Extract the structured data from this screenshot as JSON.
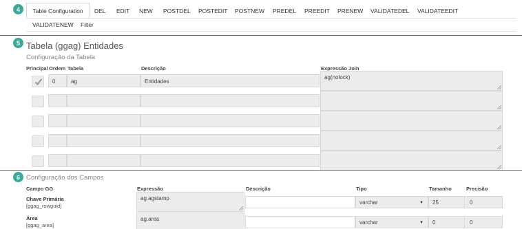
{
  "badges": {
    "tabs": "4",
    "table": "5",
    "fields": "6"
  },
  "tabs": {
    "active": "Table Configuration",
    "items": [
      "DEL",
      "EDIT",
      "NEW",
      "POSTDEL",
      "POSTEDIT",
      "POSTNEW",
      "PREDEL",
      "PREEDIT",
      "PRENEW",
      "VALIDATEDEL",
      "VALIDATEEDIT"
    ],
    "row2": [
      "VALIDATENEW",
      "Filter"
    ]
  },
  "table_section": {
    "title": "Tabela (ggag) Entidades",
    "subtitle": "Configuração da Tabela",
    "headers": {
      "principal": "Principal",
      "ordem": "Ordem",
      "tabela": "Tabela",
      "descricao": "Descrição",
      "join": "Expressão Join"
    },
    "rows": [
      {
        "checked": true,
        "ordem": "0",
        "tabela": "ag",
        "descricao": "Entidades",
        "join": "ag(nolock)"
      },
      {
        "checked": false,
        "ordem": "",
        "tabela": "",
        "descricao": "",
        "join": ""
      },
      {
        "checked": false,
        "ordem": "",
        "tabela": "",
        "descricao": "",
        "join": ""
      },
      {
        "checked": false,
        "ordem": "",
        "tabela": "",
        "descricao": "",
        "join": ""
      },
      {
        "checked": false,
        "ordem": "",
        "tabela": "",
        "descricao": "",
        "join": ""
      }
    ]
  },
  "fields_section": {
    "subtitle": "Configuração dos Campos",
    "headers": {
      "campo": "Campo GG",
      "expressao": "Expressão",
      "descricao": "Descrição",
      "tipo": "Tipo",
      "tamanho": "Tamanho",
      "precisao": "Precisão"
    },
    "rows": [
      {
        "label": "Chave Primária",
        "code": "[ggag_rowguid]",
        "expressao": "ag.agstamp",
        "descricao": "",
        "tipo": "varchar",
        "tamanho": "25",
        "precisao": "0"
      },
      {
        "label": "Área",
        "code": "[ggag_area]",
        "expressao": "ag.area",
        "descricao": "",
        "tipo": "varchar",
        "tamanho": "0",
        "precisao": "0"
      }
    ]
  }
}
